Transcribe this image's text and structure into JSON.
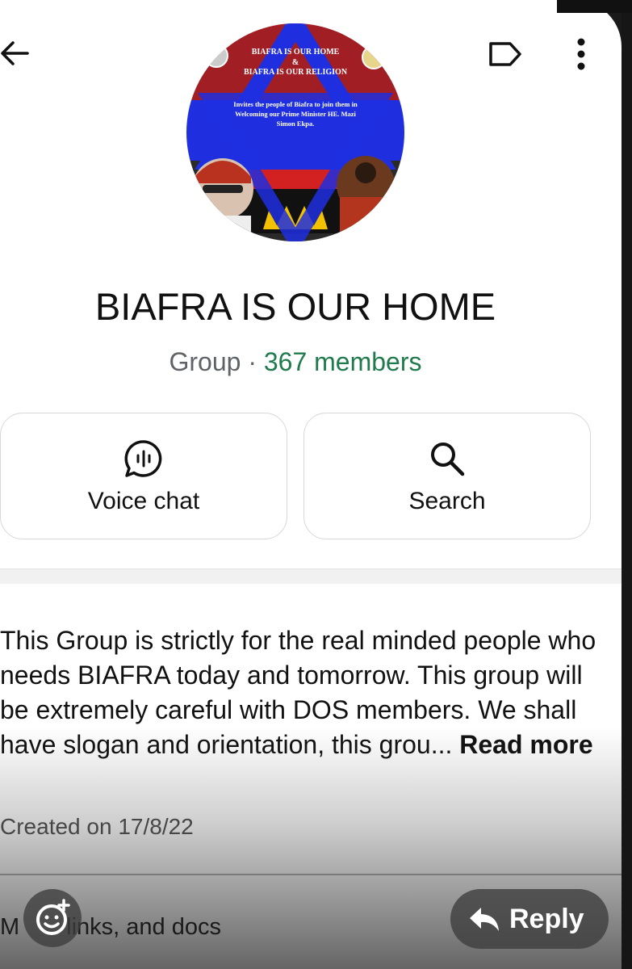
{
  "header": {
    "back_icon": "arrow-left-icon",
    "label_icon": "label-outline-icon",
    "more_icon": "more-vertical-icon"
  },
  "avatar": {
    "line1": "BIAFRA IS OUR HOME",
    "line2": "&",
    "line3": "BIAFRA IS OUR RELIGION",
    "line4": "Invites the people of Biafra to join them in",
    "line5": "Welcoming our Prime Minister HE. Mazi",
    "line6": "Simon Ekpa."
  },
  "group": {
    "title": "BIAFRA IS OUR HOME",
    "type": "Group",
    "separator": " · ",
    "members": "367 members"
  },
  "actions": [
    {
      "label": "Voice chat",
      "icon": "voice-chat-icon"
    },
    {
      "label": "Search",
      "icon": "search-icon"
    }
  ],
  "description": {
    "text": "This Group is strictly for the real minded people who needs BIAFRA today and tomorrow. This group will be extremely careful with DOS members. We shall have slogan and orientation, this grou... ",
    "read_more": "Read more",
    "created": "Created on 17/8/22"
  },
  "media_row": {
    "label_start": "M",
    "label_end": "links, and docs"
  },
  "overlay": {
    "reply_label": "Reply",
    "reply_icon": "reply-arrow-icon",
    "react_icon": "add-reaction-icon"
  },
  "colors": {
    "members_green": "#1f7a4d",
    "flag_red": "#a11f24",
    "flag_blue": "#1f2fe0",
    "text_dark": "#111111"
  }
}
